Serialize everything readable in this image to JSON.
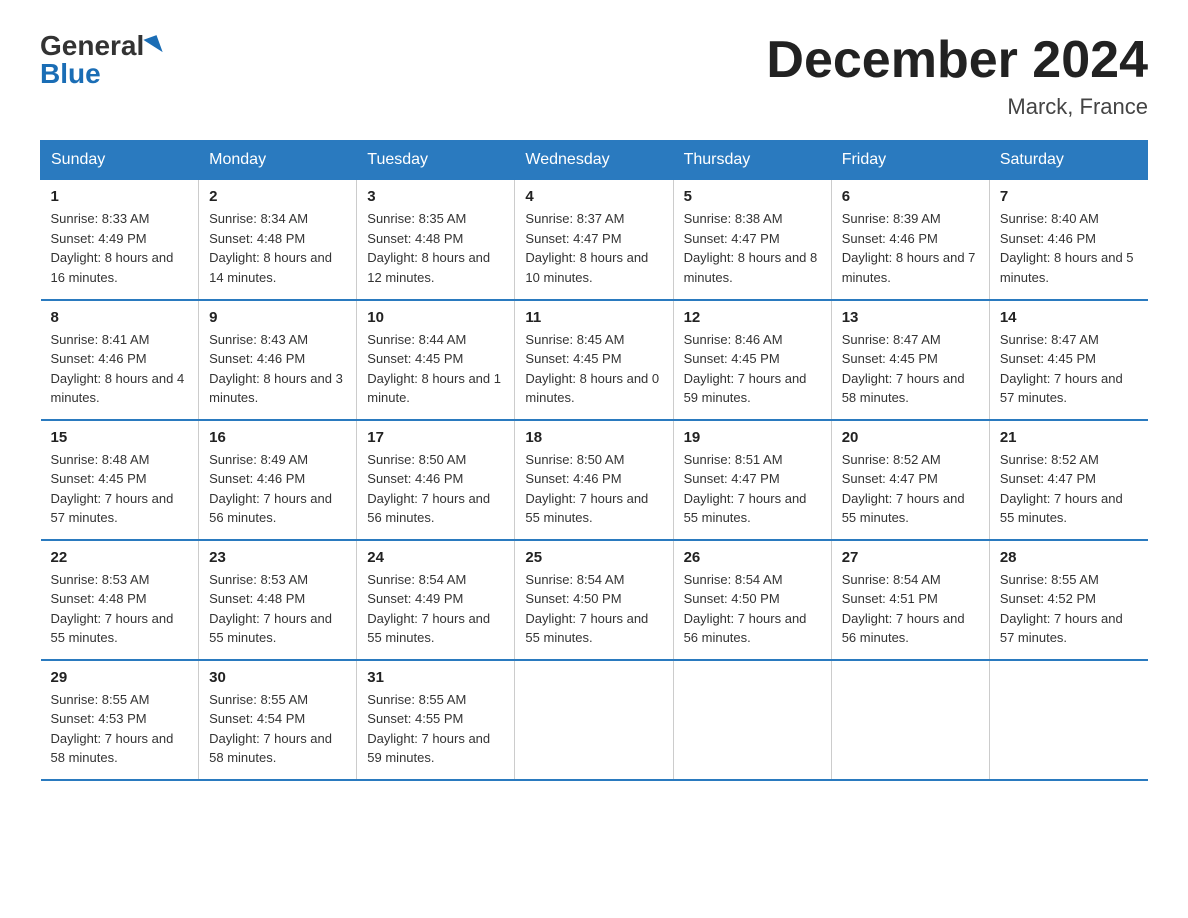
{
  "logo": {
    "text1": "General",
    "text2": "Blue"
  },
  "title": "December 2024",
  "location": "Marck, France",
  "days_header": [
    "Sunday",
    "Monday",
    "Tuesday",
    "Wednesday",
    "Thursday",
    "Friday",
    "Saturday"
  ],
  "weeks": [
    [
      {
        "day": "1",
        "sunrise": "8:33 AM",
        "sunset": "4:49 PM",
        "daylight": "8 hours and 16 minutes."
      },
      {
        "day": "2",
        "sunrise": "8:34 AM",
        "sunset": "4:48 PM",
        "daylight": "8 hours and 14 minutes."
      },
      {
        "day": "3",
        "sunrise": "8:35 AM",
        "sunset": "4:48 PM",
        "daylight": "8 hours and 12 minutes."
      },
      {
        "day": "4",
        "sunrise": "8:37 AM",
        "sunset": "4:47 PM",
        "daylight": "8 hours and 10 minutes."
      },
      {
        "day": "5",
        "sunrise": "8:38 AM",
        "sunset": "4:47 PM",
        "daylight": "8 hours and 8 minutes."
      },
      {
        "day": "6",
        "sunrise": "8:39 AM",
        "sunset": "4:46 PM",
        "daylight": "8 hours and 7 minutes."
      },
      {
        "day": "7",
        "sunrise": "8:40 AM",
        "sunset": "4:46 PM",
        "daylight": "8 hours and 5 minutes."
      }
    ],
    [
      {
        "day": "8",
        "sunrise": "8:41 AM",
        "sunset": "4:46 PM",
        "daylight": "8 hours and 4 minutes."
      },
      {
        "day": "9",
        "sunrise": "8:43 AM",
        "sunset": "4:46 PM",
        "daylight": "8 hours and 3 minutes."
      },
      {
        "day": "10",
        "sunrise": "8:44 AM",
        "sunset": "4:45 PM",
        "daylight": "8 hours and 1 minute."
      },
      {
        "day": "11",
        "sunrise": "8:45 AM",
        "sunset": "4:45 PM",
        "daylight": "8 hours and 0 minutes."
      },
      {
        "day": "12",
        "sunrise": "8:46 AM",
        "sunset": "4:45 PM",
        "daylight": "7 hours and 59 minutes."
      },
      {
        "day": "13",
        "sunrise": "8:47 AM",
        "sunset": "4:45 PM",
        "daylight": "7 hours and 58 minutes."
      },
      {
        "day": "14",
        "sunrise": "8:47 AM",
        "sunset": "4:45 PM",
        "daylight": "7 hours and 57 minutes."
      }
    ],
    [
      {
        "day": "15",
        "sunrise": "8:48 AM",
        "sunset": "4:45 PM",
        "daylight": "7 hours and 57 minutes."
      },
      {
        "day": "16",
        "sunrise": "8:49 AM",
        "sunset": "4:46 PM",
        "daylight": "7 hours and 56 minutes."
      },
      {
        "day": "17",
        "sunrise": "8:50 AM",
        "sunset": "4:46 PM",
        "daylight": "7 hours and 56 minutes."
      },
      {
        "day": "18",
        "sunrise": "8:50 AM",
        "sunset": "4:46 PM",
        "daylight": "7 hours and 55 minutes."
      },
      {
        "day": "19",
        "sunrise": "8:51 AM",
        "sunset": "4:47 PM",
        "daylight": "7 hours and 55 minutes."
      },
      {
        "day": "20",
        "sunrise": "8:52 AM",
        "sunset": "4:47 PM",
        "daylight": "7 hours and 55 minutes."
      },
      {
        "day": "21",
        "sunrise": "8:52 AM",
        "sunset": "4:47 PM",
        "daylight": "7 hours and 55 minutes."
      }
    ],
    [
      {
        "day": "22",
        "sunrise": "8:53 AM",
        "sunset": "4:48 PM",
        "daylight": "7 hours and 55 minutes."
      },
      {
        "day": "23",
        "sunrise": "8:53 AM",
        "sunset": "4:48 PM",
        "daylight": "7 hours and 55 minutes."
      },
      {
        "day": "24",
        "sunrise": "8:54 AM",
        "sunset": "4:49 PM",
        "daylight": "7 hours and 55 minutes."
      },
      {
        "day": "25",
        "sunrise": "8:54 AM",
        "sunset": "4:50 PM",
        "daylight": "7 hours and 55 minutes."
      },
      {
        "day": "26",
        "sunrise": "8:54 AM",
        "sunset": "4:50 PM",
        "daylight": "7 hours and 56 minutes."
      },
      {
        "day": "27",
        "sunrise": "8:54 AM",
        "sunset": "4:51 PM",
        "daylight": "7 hours and 56 minutes."
      },
      {
        "day": "28",
        "sunrise": "8:55 AM",
        "sunset": "4:52 PM",
        "daylight": "7 hours and 57 minutes."
      }
    ],
    [
      {
        "day": "29",
        "sunrise": "8:55 AM",
        "sunset": "4:53 PM",
        "daylight": "7 hours and 58 minutes."
      },
      {
        "day": "30",
        "sunrise": "8:55 AM",
        "sunset": "4:54 PM",
        "daylight": "7 hours and 58 minutes."
      },
      {
        "day": "31",
        "sunrise": "8:55 AM",
        "sunset": "4:55 PM",
        "daylight": "7 hours and 59 minutes."
      },
      null,
      null,
      null,
      null
    ]
  ]
}
